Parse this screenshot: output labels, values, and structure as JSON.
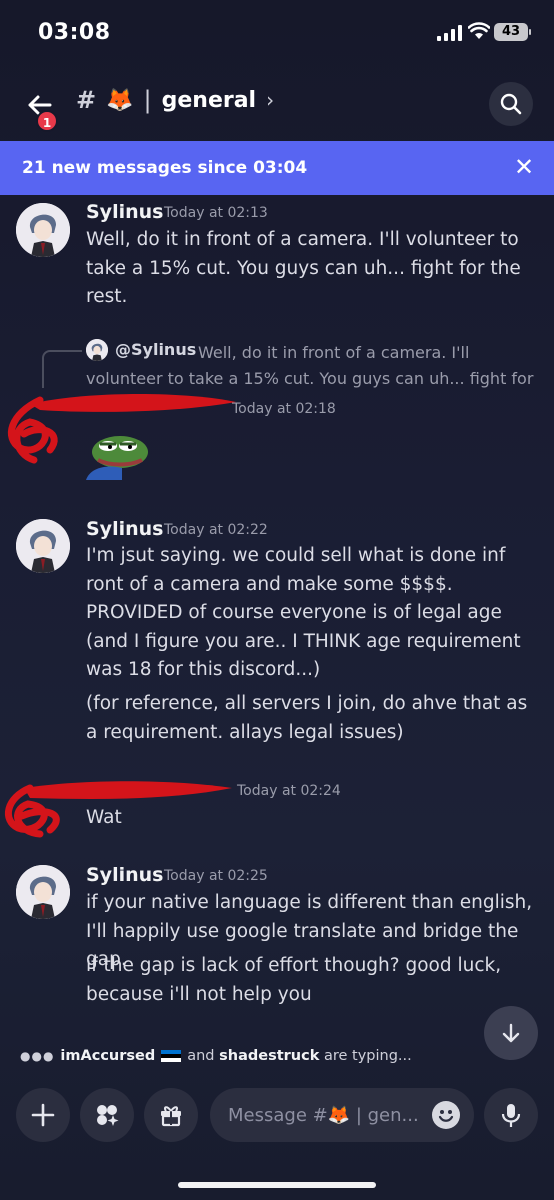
{
  "status": {
    "time": "03:08",
    "battery": "43"
  },
  "header": {
    "badge": "1",
    "hash": "#",
    "emoji": "🦊",
    "separator": "|",
    "channel": "general",
    "chevron": "›"
  },
  "new_messages_bar": {
    "text": "21 new messages since 03:04",
    "close": "✕"
  },
  "messages": [
    {
      "author": "Sylinus",
      "time": "Today at 02:13",
      "paragraphs": [
        "Well, do it in front of a camera. I'll volunteer to take a 15% cut. You guys can uh... fight for the rest."
      ]
    },
    {
      "reply": {
        "author": "@Sylinus",
        "text": "Well, do it in front of a camera. I'll volunteer to take a 15% cut. You guys can uh... fight for ..."
      },
      "time": "Today at 02:18"
    },
    {
      "author": "Sylinus",
      "time": "Today at 02:22",
      "paragraphs": [
        "I'm jsut saying. we could sell what is done inf ront of a camera and make some $$$$. PROVIDED of course everyone is of legal age (and I figure you are.. I THINK age requirement was 18 for this discord...)",
        "(for reference, all servers I join, do ahve that as a requirement. allays legal issues)"
      ]
    },
    {
      "time": "Today at 02:24",
      "paragraphs": [
        "Wat"
      ]
    },
    {
      "author": "Sylinus",
      "time": "Today at 02:25",
      "paragraphs": [
        "if your native language is different than english, I'll happily use google translate and bridge the gap.",
        "if the gap is lack of effort though? good luck, because i'll not help you"
      ]
    }
  ],
  "typing": {
    "user1": "imAccursed",
    "and": "and",
    "user2": "shadestruck",
    "suffix": "are typing..."
  },
  "composer": {
    "placeholder": "Message #🦊 | gen..."
  },
  "colors": {
    "accent": "#5865f2",
    "background": "#1a1d33",
    "badge": "#e8394a"
  }
}
